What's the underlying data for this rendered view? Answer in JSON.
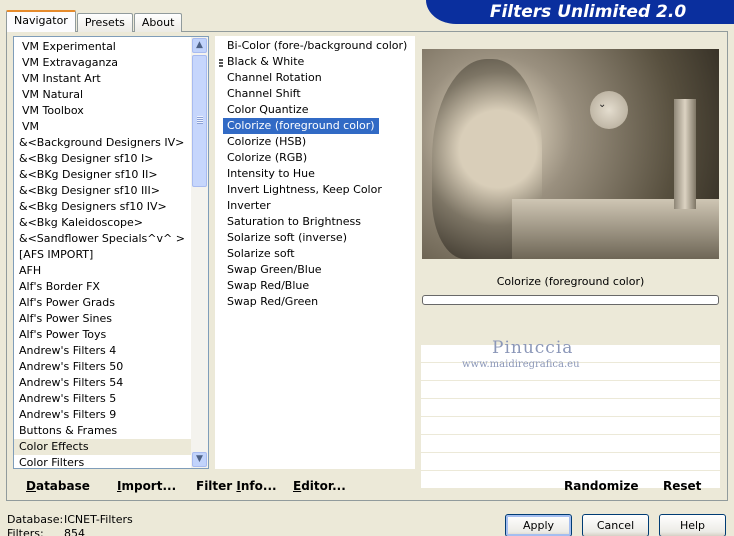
{
  "window": {
    "banner_title": "Filters Unlimited 2.0"
  },
  "tabs": [
    {
      "label": "Navigator",
      "active": true
    },
    {
      "label": "Presets",
      "active": false
    },
    {
      "label": "About",
      "active": false
    }
  ],
  "categories": {
    "items": [
      "VM Experimental",
      "VM Extravaganza",
      "VM Instant Art",
      "VM Natural",
      "VM Toolbox",
      "VM",
      "&<Background Designers IV>",
      "&<Bkg Designer sf10 I>",
      "&<BKg Designer sf10 II>",
      "&<Bkg Designer sf10 III>",
      "&<Bkg Designers sf10 IV>",
      "&<Bkg Kaleidoscope>",
      "&<Sandflower Specials^v^ >",
      "[AFS IMPORT]",
      "AFH",
      "Alf's Border FX",
      "Alf's Power Grads",
      "Alf's Power Sines",
      "Alf's Power Toys",
      "Andrew's Filters 4",
      "Andrew's Filters 50",
      "Andrew's Filters 54",
      "Andrew's Filters 5",
      "Andrew's Filters 9",
      "Buttons & Frames",
      "Color Effects",
      "Color Filters"
    ],
    "selected": "Color Effects",
    "scroll_up_icon": "up-arrow-icon",
    "scroll_down_icon": "down-arrow-icon"
  },
  "filters": {
    "items": [
      "Bi-Color (fore-/background color)",
      "Black & White",
      "Channel Rotation",
      "Channel Shift",
      "Color Quantize",
      "Colorize (foreground color)",
      "Colorize (HSB)",
      "Colorize (RGB)",
      "Intensity to Hue",
      "Invert Lightness, Keep Color",
      "Inverter",
      "Saturation to Brightness",
      "Solarize soft (inverse)",
      "Solarize soft",
      "Swap Green/Blue",
      "Swap Red/Blue",
      "Swap Red/Green"
    ],
    "selected": "Colorize (foreground color)"
  },
  "preview": {
    "status_label": "Colorize (foreground color)",
    "progress": 0
  },
  "watermark": {
    "name": "Pinuccia",
    "url": "www.maidiregrafica.eu"
  },
  "toolbar": {
    "database": {
      "u": "D",
      "rest": "atabase"
    },
    "import": {
      "u": "I",
      "rest": "mport..."
    },
    "filter_info": {
      "pre": "Filter ",
      "u": "I",
      "rest": "nfo..."
    },
    "editor": {
      "u": "E",
      "rest": "ditor..."
    },
    "randomize": "Randomize",
    "reset": "Reset"
  },
  "info": {
    "database_label": "Database:",
    "database_value": "ICNET-Filters",
    "filters_label": "Filters:",
    "filters_value": "854"
  },
  "dialog": {
    "apply": "Apply",
    "cancel": "Cancel",
    "help": "Help"
  }
}
